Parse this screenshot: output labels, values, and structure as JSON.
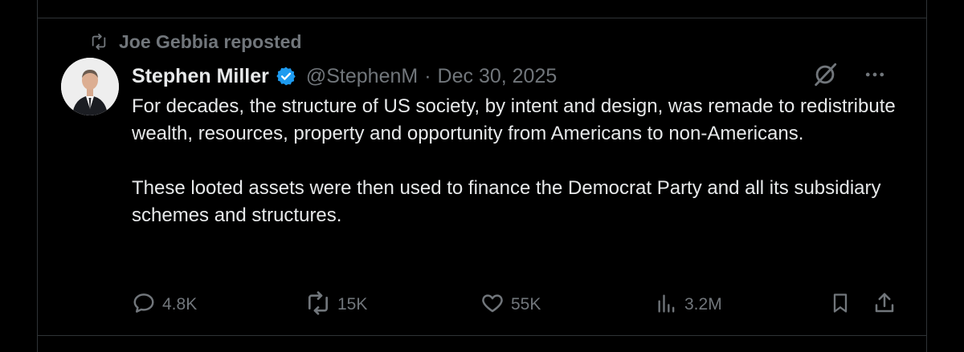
{
  "social_context": {
    "text": "Joe Gebbia reposted",
    "icon": "repost-icon"
  },
  "author": {
    "display_name": "Stephen Miller",
    "verified": true,
    "handle": "@StephenM",
    "separator": "·",
    "date": "Dec 30, 2025",
    "avatar": "profile-photo"
  },
  "top_actions": {
    "grok_icon": "grok-icon",
    "more_icon": "more-icon"
  },
  "post": {
    "paragraphs": [
      "For decades, the structure of US society, by intent and design, was remade to redistribute wealth, resources, property and opportunity from Americans to non-Americans.",
      "These looted assets were then used to finance the Democrat Party and all its subsidiary schemes and structures."
    ]
  },
  "actions": {
    "replies": {
      "icon": "reply-icon",
      "count": "4.8K"
    },
    "reposts": {
      "icon": "repost-icon",
      "count": "15K"
    },
    "likes": {
      "icon": "heart-icon",
      "count": "55K"
    },
    "views": {
      "icon": "views-icon",
      "count": "3.2M"
    },
    "bookmark": {
      "icon": "bookmark-icon"
    },
    "share": {
      "icon": "share-icon"
    }
  },
  "colors": {
    "background": "#000000",
    "text_primary": "#e7e9ea",
    "text_secondary": "#71767b",
    "border": "#2f3336",
    "verified_blue": "#1d9bf0"
  }
}
